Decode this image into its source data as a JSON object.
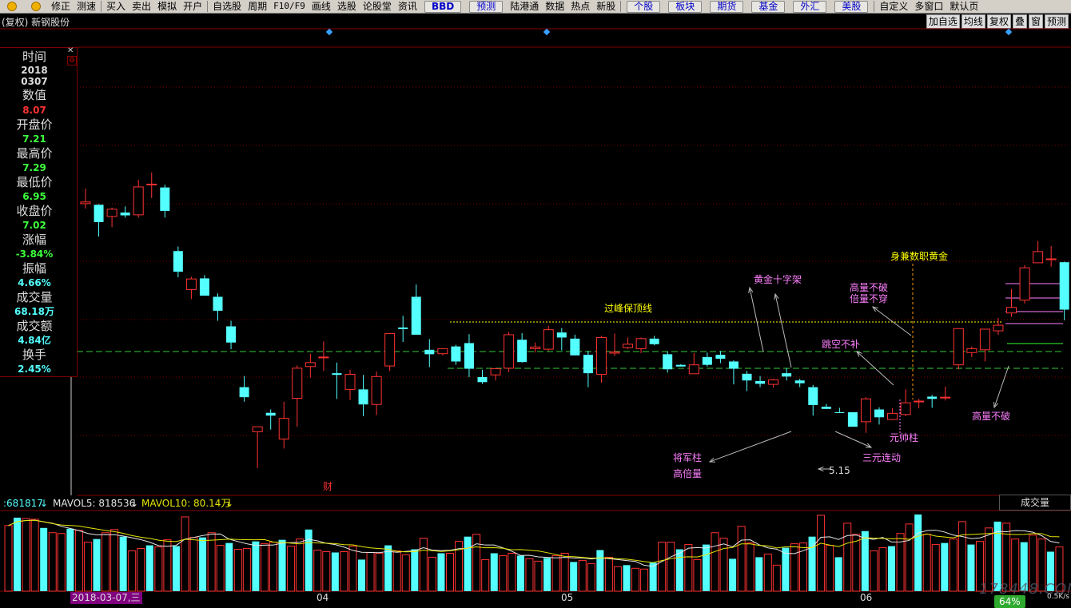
{
  "toolbar": {
    "items": [
      "修正",
      "测速",
      "买入",
      "卖出",
      "模拟",
      "开户",
      "自选股",
      "周期",
      "F10/F9",
      "画线",
      "选股",
      "论股堂",
      "资讯",
      "BBD",
      "预测",
      "陆港通",
      "数据",
      "热点",
      "新股",
      "个股",
      "板块",
      "期货",
      "基金",
      "外汇",
      "美股",
      "自定义",
      "多窗口",
      "默认页"
    ]
  },
  "header": {
    "title": "(复权) 新钢股份",
    "buttons": [
      "加自选",
      "均线",
      "复权",
      "叠",
      "窗",
      "预测"
    ]
  },
  "info": {
    "time_label": "时间",
    "time_year": "2018",
    "time_md": "0307",
    "value_label": "数值",
    "value": "8.07",
    "open_label": "开盘价",
    "open": "7.21",
    "high_label": "最高价",
    "high": "7.29",
    "low_label": "最低价",
    "low": "6.95",
    "close_label": "收盘价",
    "close": "7.02",
    "chg_label": "涨幅",
    "chg": "-3.84%",
    "amp_label": "振幅",
    "amp": "4.66%",
    "vol_label": "成交量",
    "vol": "68.18万",
    "amt_label": "成交额",
    "amt": "4.84亿",
    "turn_label": "换手",
    "turn": "2.45%"
  },
  "volume_panel": {
    "vol": ":681817",
    "mavol5": "MAVOL5: 818536",
    "mavol10": "MAVOL10: 80.14万",
    "name": "成交量"
  },
  "x_axis": {
    "date_label": "2018-03-07,三",
    "months": [
      "04",
      "05",
      "06"
    ]
  },
  "annotations": {
    "top_line": "过峰保顶线",
    "cross": "黄金十字架",
    "gold": "身兼数职黄金",
    "high_not_break": "高量不破",
    "double_not_pierce": "倍量不穿",
    "gap": "跳空不补",
    "marshal": "元帅柱",
    "three": "三元连动",
    "general": "将军柱",
    "high_double": "高倍量",
    "low_price": "5.15",
    "high_not_break2": "高量不破",
    "cai": "财"
  },
  "status": {
    "percent": "64%",
    "speed": "0.5K/s",
    "watermark": "178448.COM"
  },
  "colors": {
    "up": "#ff3232",
    "down": "#54ffff",
    "grid": "#800000",
    "ma5": "#e6e6e6",
    "ma10": "#e6e600",
    "label_purple": "#ff80ff",
    "label_yellow": "#ffff00"
  },
  "candles": [
    [
      6.95,
      7.22,
      6.86,
      6.98
    ],
    [
      6.93,
      6.94,
      6.36,
      6.62
    ],
    [
      6.72,
      6.88,
      6.53,
      6.85
    ],
    [
      6.79,
      6.9,
      6.7,
      6.74
    ],
    [
      6.75,
      7.38,
      6.7,
      7.25
    ],
    [
      7.3,
      7.51,
      7.05,
      7.3
    ],
    [
      7.24,
      7.29,
      6.7,
      6.82
    ],
    [
      6.1,
      6.18,
      5.63,
      5.73
    ],
    [
      5.41,
      5.64,
      5.24,
      5.6
    ],
    [
      5.61,
      5.67,
      5.3,
      5.3
    ],
    [
      5.28,
      5.34,
      4.85,
      5.03
    ],
    [
      4.75,
      4.85,
      4.34,
      4.46
    ],
    [
      3.66,
      3.86,
      3.4,
      3.48
    ],
    [
      2.86,
      2.95,
      2.21,
      2.95
    ],
    [
      3.2,
      3.26,
      2.9,
      3.15
    ],
    [
      2.73,
      3.4,
      2.56,
      3.1
    ],
    [
      3.46,
      4.05,
      2.95,
      4.0
    ],
    [
      4.03,
      4.26,
      3.83,
      4.1
    ],
    [
      4.2,
      4.48,
      3.95,
      4.2
    ],
    [
      3.91,
      4.1,
      3.45,
      3.88
    ],
    [
      3.62,
      3.97,
      3.43,
      3.89
    ],
    [
      3.62,
      3.88,
      3.14,
      3.35
    ],
    [
      3.35,
      3.94,
      3.16,
      3.85
    ],
    [
      4.04,
      4.62,
      3.95,
      4.62
    ],
    [
      4.73,
      4.94,
      4.47,
      4.7
    ],
    [
      5.28,
      5.5,
      4.6,
      4.6
    ],
    [
      4.33,
      4.52,
      4.02,
      4.25
    ],
    [
      4.26,
      4.35,
      4.23,
      4.35
    ],
    [
      4.39,
      4.42,
      4.06,
      4.12
    ],
    [
      4.45,
      4.61,
      3.84,
      3.99
    ],
    [
      3.84,
      3.97,
      3.72,
      3.75
    ],
    [
      3.88,
      3.99,
      3.78,
      3.99
    ],
    [
      4.0,
      4.65,
      3.93,
      4.6
    ],
    [
      4.51,
      4.63,
      4.1,
      4.11
    ],
    [
      4.35,
      4.46,
      4.28,
      4.38
    ],
    [
      4.34,
      4.76,
      4.31,
      4.69
    ],
    [
      4.64,
      4.72,
      4.32,
      4.55
    ],
    [
      4.53,
      4.6,
      4.23,
      4.23
    ],
    [
      4.24,
      4.31,
      3.66,
      3.91
    ],
    [
      3.89,
      4.58,
      3.74,
      4.55
    ],
    [
      4.27,
      4.62,
      4.22,
      4.29
    ],
    [
      4.37,
      4.55,
      4.34,
      4.43
    ],
    [
      4.35,
      4.55,
      4.27,
      4.53
    ],
    [
      4.53,
      4.58,
      4.41,
      4.43
    ],
    [
      4.25,
      4.3,
      3.92,
      3.98
    ],
    [
      4.06,
      4.07,
      4.03,
      4.03
    ],
    [
      3.9,
      4.27,
      3.9,
      4.06
    ],
    [
      4.2,
      4.28,
      4.03,
      4.06
    ],
    [
      4.24,
      4.31,
      4.09,
      4.17
    ],
    [
      4.12,
      4.14,
      3.71,
      3.99
    ],
    [
      3.9,
      3.95,
      3.59,
      3.78
    ],
    [
      3.77,
      3.86,
      3.66,
      3.72
    ],
    [
      3.71,
      3.81,
      3.65,
      3.79
    ],
    [
      3.91,
      4.0,
      3.78,
      3.85
    ],
    [
      3.78,
      3.81,
      3.66,
      3.73
    ],
    [
      3.66,
      3.7,
      3.15,
      3.34
    ],
    [
      3.31,
      3.36,
      3.27,
      3.27
    ],
    [
      3.21,
      3.29,
      3.2,
      3.2
    ],
    [
      3.21,
      3.21,
      2.95,
      2.95
    ],
    [
      3.04,
      3.48,
      2.84,
      3.45
    ],
    [
      3.26,
      3.3,
      2.99,
      3.12
    ],
    [
      3.08,
      3.28,
      3.07,
      3.19
    ],
    [
      3.17,
      3.62,
      3.14,
      3.38
    ],
    [
      3.41,
      3.45,
      3.28,
      3.41
    ],
    [
      3.49,
      3.52,
      3.29,
      3.45
    ],
    [
      3.48,
      3.67,
      3.42,
      3.48
    ],
    [
      4.06,
      4.71,
      3.98,
      4.71
    ],
    [
      4.28,
      4.39,
      4.2,
      4.35
    ],
    [
      4.33,
      4.68,
      4.12,
      4.7
    ],
    [
      4.67,
      4.9,
      4.6,
      4.77
    ],
    [
      4.99,
      5.42,
      4.92,
      5.09
    ],
    [
      5.22,
      5.85,
      5.16,
      5.8
    ],
    [
      5.89,
      6.28,
      5.89,
      6.09
    ],
    [
      5.96,
      6.19,
      5.82,
      5.96
    ],
    [
      5.9,
      5.91,
      4.86,
      5.05
    ],
    [
      5.04,
      5.57,
      5.04,
      5.9
    ],
    [
      5.6,
      6.07,
      5.38,
      5.2
    ],
    [
      5.22,
      5.52,
      5.0,
      5.28
    ]
  ],
  "volumes": [
    0.83,
    0.93,
    0.92,
    0.91,
    0.8,
    0.74,
    0.73,
    0.79,
    0.77,
    0.62,
    0.66,
    0.74,
    0.78,
    0.69,
    0.51,
    0.54,
    0.58,
    0.56,
    0.65,
    0.57,
    0.94,
    0.68,
    0.68,
    0.74,
    0.58,
    0.61,
    0.53,
    0.54,
    0.63,
    0.6,
    0.62,
    0.65,
    0.57,
    0.66,
    0.78,
    0.52,
    0.5,
    0.49,
    0.5,
    0.57,
    0.4,
    0.49,
    0.48,
    0.58,
    0.51,
    0.46,
    0.53,
    0.67,
    0.43,
    0.48,
    0.48,
    0.63,
    0.69,
    0.72,
    0.4,
    0.48,
    0.45,
    0.48,
    0.45,
    0.41,
    0.38,
    0.42,
    0.45,
    0.48,
    0.37,
    0.39,
    0.35,
    0.52,
    0.43,
    0.31,
    0.33,
    0.29,
    0.28,
    0.36,
    0.62,
    0.62,
    0.53,
    0.59,
    0.4,
    0.59,
    0.74,
    0.67,
    0.41,
    0.82,
    0.61,
    0.43,
    0.47,
    0.33,
    0.55,
    0.6,
    0.61,
    0.69,
    0.96,
    0.58,
    0.43,
    0.86,
    0.72,
    0.76,
    0.51,
    0.55,
    0.57,
    0.73,
    0.85,
    0.97,
    0.72,
    0.59,
    0.61,
    0.66,
    0.88,
    0.59,
    0.63,
    0.8,
    0.88,
    0.86,
    0.66,
    0.62,
    0.71,
    0.66,
    0.5,
    0.56
  ]
}
